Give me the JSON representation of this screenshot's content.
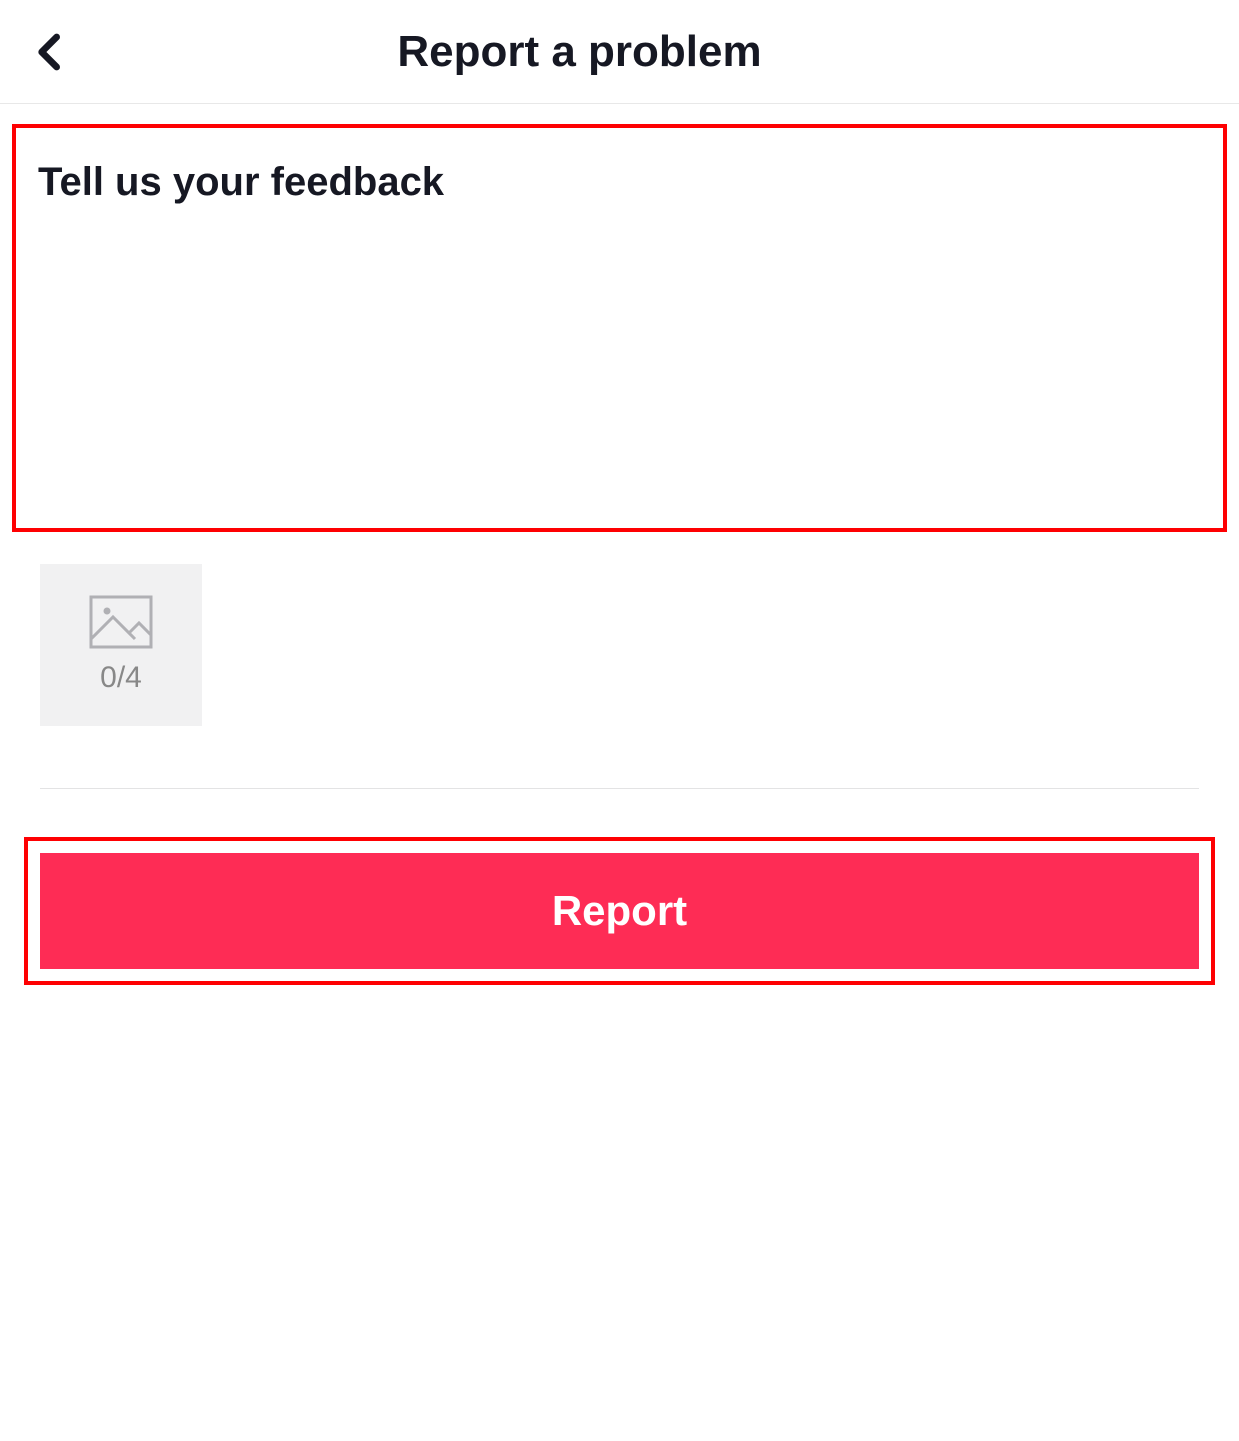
{
  "header": {
    "title": "Report a problem"
  },
  "feedback": {
    "placeholder": "Tell us your feedback",
    "value": ""
  },
  "attachment": {
    "current": 0,
    "max": 4,
    "count_label": "0/4"
  },
  "submit": {
    "label": "Report"
  },
  "colors": {
    "highlight_border": "#fe0002",
    "primary_button": "#fe2c55"
  }
}
